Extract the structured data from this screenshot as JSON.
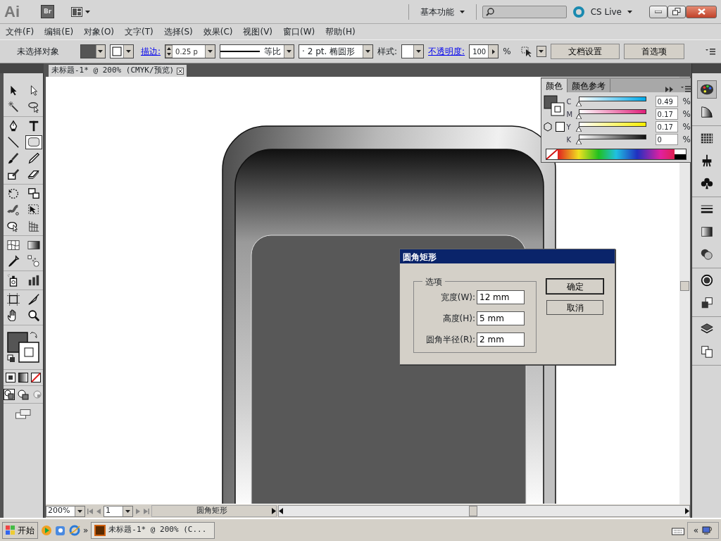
{
  "title_bar": {
    "app_logo": "Ai",
    "bridge_button": "Br",
    "workspace": "基本功能",
    "cs_live": "CS Live"
  },
  "menu": [
    "文件(F)",
    "编辑(E)",
    "对象(O)",
    "文字(T)",
    "选择(S)",
    "效果(C)",
    "视图(V)",
    "窗口(W)",
    "帮助(H)"
  ],
  "control_bar": {
    "selection": "未选择对象",
    "stroke_label": "描边:",
    "stroke_weight": "0.25 p",
    "stroke_profile": "等比",
    "brush_marker": "·",
    "brush": "2 pt. 椭圆形",
    "style_label": "样式:",
    "opacity_label": "不透明度:",
    "opacity": "100",
    "opacity_unit": "%",
    "buttons": [
      "文档设置",
      "首选项"
    ]
  },
  "document_tab": {
    "title": "未标题-1* @ 200% (CMYK/预览)"
  },
  "tool_groups": [
    [
      {
        "kind": "selection",
        "selected": false
      },
      {
        "kind": "direct-selection",
        "selected": false
      },
      {
        "kind": "magic-wand",
        "selected": false
      },
      {
        "kind": "lasso",
        "selected": false
      }
    ],
    [
      {
        "kind": "pen",
        "selected": false
      },
      {
        "kind": "type",
        "selected": false
      },
      {
        "kind": "line",
        "selected": false
      },
      {
        "kind": "rounded-rectangle",
        "selected": true
      },
      {
        "kind": "paintbrush",
        "selected": false
      },
      {
        "kind": "pencil",
        "selected": false
      },
      {
        "kind": "blob-brush",
        "selected": false
      },
      {
        "kind": "eraser",
        "selected": false
      }
    ],
    [
      {
        "kind": "rotate",
        "selected": false
      },
      {
        "kind": "scale",
        "selected": false
      },
      {
        "kind": "warp",
        "selected": false
      },
      {
        "kind": "free-transform",
        "selected": false
      },
      {
        "kind": "shape-builder",
        "selected": false
      },
      {
        "kind": "perspective",
        "selected": false
      }
    ],
    [
      {
        "kind": "mesh",
        "selected": false
      },
      {
        "kind": "gradient",
        "selected": false
      },
      {
        "kind": "eyedropper",
        "selected": false
      },
      {
        "kind": "blend",
        "selected": false
      }
    ],
    [
      {
        "kind": "symbol-sprayer",
        "selected": false
      },
      {
        "kind": "column-graph",
        "selected": false
      }
    ],
    [
      {
        "kind": "artboard",
        "selected": false
      },
      {
        "kind": "slice",
        "selected": false
      },
      {
        "kind": "hand",
        "selected": false
      },
      {
        "kind": "zoom",
        "selected": false
      }
    ]
  ],
  "dock_groups": [
    [
      {
        "kind": "palette",
        "selected": true
      },
      {
        "kind": "quarter",
        "selected": false
      }
    ],
    [
      {
        "kind": "grid",
        "selected": false
      },
      {
        "kind": "brush",
        "selected": false
      },
      {
        "kind": "club",
        "selected": false
      }
    ],
    [
      {
        "kind": "lines",
        "selected": false
      },
      {
        "kind": "gradient",
        "selected": false
      },
      {
        "kind": "circles",
        "selected": false
      }
    ],
    [
      {
        "kind": "ring",
        "selected": false
      },
      {
        "kind": "squares",
        "selected": false
      }
    ],
    [
      {
        "kind": "layers",
        "selected": false
      },
      {
        "kind": "pages",
        "selected": false
      }
    ]
  ],
  "color_panel": {
    "tabs": [
      {
        "label": "颜色",
        "selected": true
      },
      {
        "label": "颜色参考",
        "selected": false
      }
    ],
    "channels": [
      {
        "name": "C",
        "value": "0.49",
        "unit": "%",
        "level": 0.0049
      },
      {
        "name": "M",
        "value": "0.17",
        "unit": "%",
        "level": 0.0017
      },
      {
        "name": "Y",
        "value": "0.17",
        "unit": "%",
        "level": 0.0017
      },
      {
        "name": "K",
        "value": "0",
        "unit": "%",
        "level": 0
      }
    ]
  },
  "dialog": {
    "title": "圆角矩形",
    "group": "选项",
    "fields": [
      {
        "label": "宽度(W):",
        "value": "12 mm"
      },
      {
        "label": "高度(H):",
        "value": "5 mm"
      },
      {
        "label": "圆角半径(R):",
        "value": "2 mm"
      }
    ],
    "buttons": [
      "确定",
      "取消"
    ]
  },
  "status_bar": {
    "zoom": "200%",
    "page": "1",
    "info": "圆角矩形"
  },
  "taskbar": {
    "start": "开始",
    "more": "»",
    "task": "未标题-1* @ 200% (C...",
    "tray_expand": "«"
  }
}
